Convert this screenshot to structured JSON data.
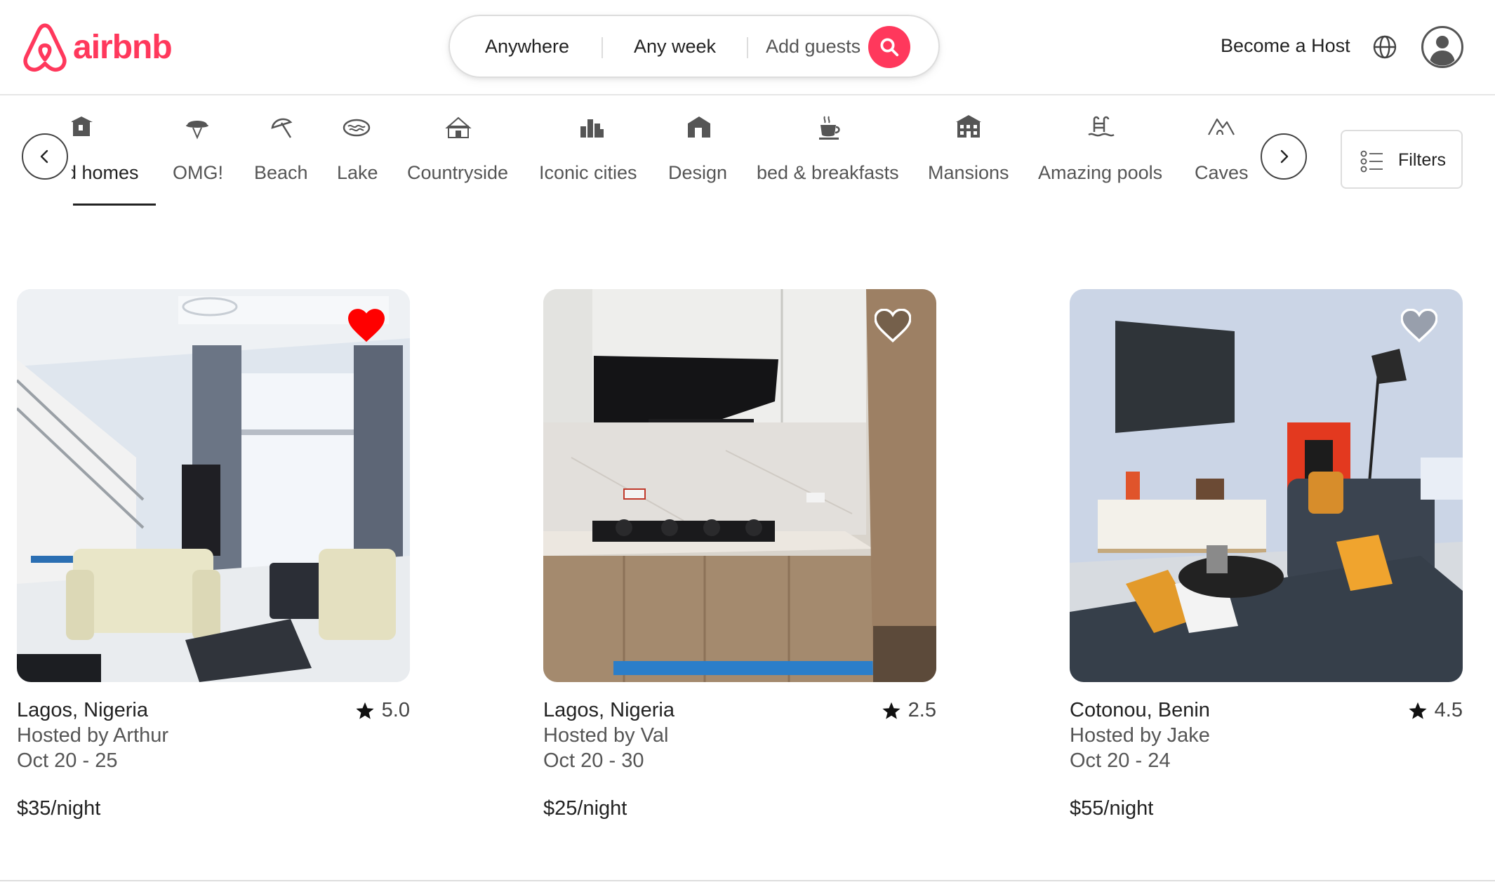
{
  "brand": {
    "name": "airbnb",
    "color": "#ff385c"
  },
  "search": {
    "anywhere": "Anywhere",
    "any_week": "Any week",
    "add_guests": "Add guests"
  },
  "header": {
    "become_host": "Become a Host"
  },
  "categories": {
    "items": [
      {
        "label": "d homes",
        "icon": "home-icon",
        "active": true
      },
      {
        "label": "OMG!",
        "icon": "ufo-house-icon",
        "active": false
      },
      {
        "label": "Beach",
        "icon": "beach-umbrella-icon",
        "active": false
      },
      {
        "label": "Lake",
        "icon": "lake-icon",
        "active": false
      },
      {
        "label": "Countryside",
        "icon": "countryside-icon",
        "active": false
      },
      {
        "label": "Iconic cities",
        "icon": "city-icon",
        "active": false
      },
      {
        "label": "Design",
        "icon": "design-icon",
        "active": false
      },
      {
        "label": "bed & breakfasts",
        "icon": "coffee-cup-icon",
        "active": false
      },
      {
        "label": "Mansions",
        "icon": "mansion-icon",
        "active": false
      },
      {
        "label": "Amazing pools",
        "icon": "pool-icon",
        "active": false
      },
      {
        "label": "Caves",
        "icon": "cave-icon",
        "active": false
      }
    ],
    "filters_label": "Filters"
  },
  "listings": [
    {
      "location": "Lagos, Nigeria",
      "rating": "5.0",
      "host": "Hosted by Arthur",
      "dates": "Oct 20 - 25",
      "price": "$35/night",
      "favorited": true,
      "photo": "living room with staircase"
    },
    {
      "location": "Lagos, Nigeria",
      "rating": "2.5",
      "host": "Hosted by Val",
      "dates": "Oct 20 - 30",
      "price": "$25/night",
      "favorited": false,
      "photo": "kitchen with cooktop and range hood"
    },
    {
      "location": "Cotonou, Benin",
      "rating": "4.5",
      "host": "Hosted by Jake",
      "dates": "Oct 20 - 24",
      "price": "$55/night",
      "favorited": false,
      "photo": "living room with TV and sofa"
    }
  ],
  "colors": {
    "accent": "#ff385c",
    "heart_active": "#ff0000",
    "text": "#222222",
    "muted": "#555555",
    "border": "#dddddd"
  }
}
